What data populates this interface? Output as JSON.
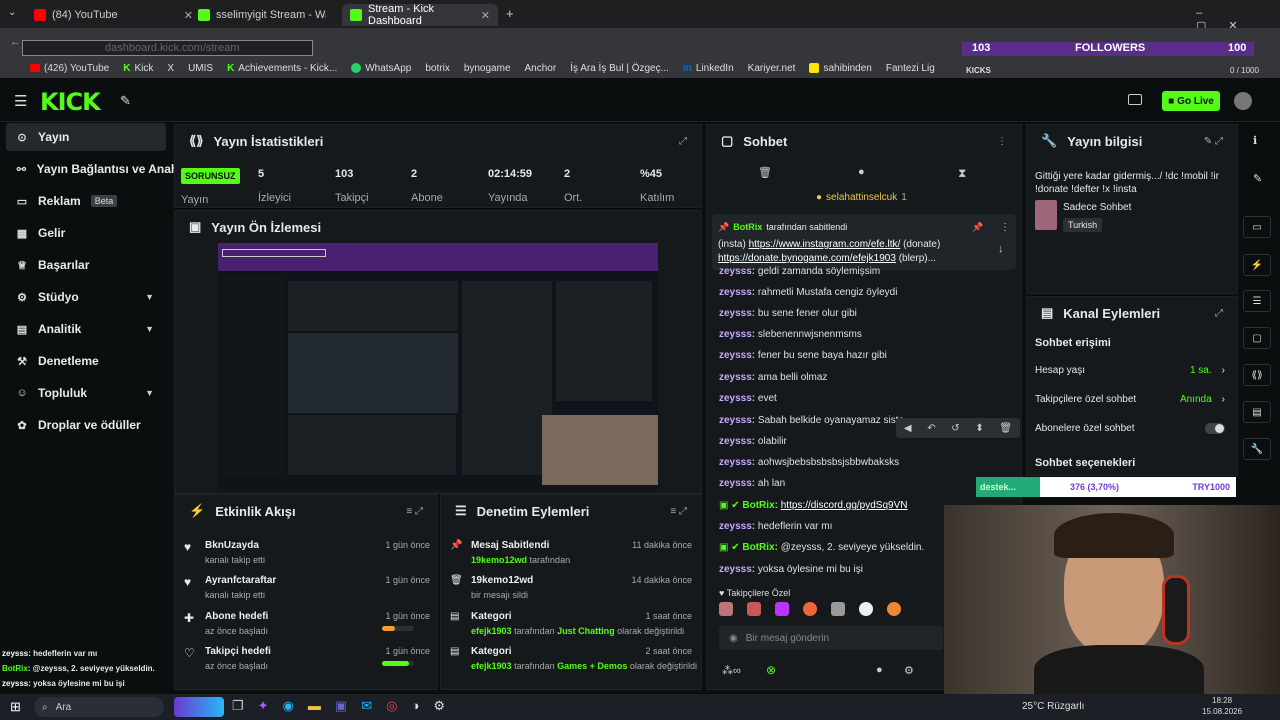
{
  "browser": {
    "tabs": [
      {
        "label": "(84) YouTube",
        "active": false
      },
      {
        "label": "sselimyigit Stream - Watch Live",
        "active": false
      },
      {
        "label": "Stream - Kick Dashboard",
        "active": true
      }
    ],
    "url": "dashboard.kick.com/stream",
    "bookmarks": [
      "(426) YouTube",
      "Kick",
      "X",
      "UMIS",
      "Achievements - Kick...",
      "WhatsApp",
      "botrix",
      "bynogame",
      "Anchor",
      "İş Ara İş Bul | Özgeç...",
      "LinkedIn",
      "Kariyer.net",
      "sahibinden",
      "Fantezi Lig"
    ]
  },
  "overlay": {
    "followers_left": "103",
    "followers_label": "FOLLOWERS",
    "followers_right": "100",
    "kicks_label": "KICKS",
    "kicks_value": "0 / 1000",
    "donation_name": "destek...",
    "donation_pct": "376 (3,70%)",
    "donation_goal": "TRY1000"
  },
  "header": {
    "logo": "KICK",
    "golive": "Go Live"
  },
  "sidebar": {
    "items": [
      {
        "label": "Yayın",
        "icon": "broadcast-icon"
      },
      {
        "label": "Yayın Bağlantısı ve Anahtar",
        "icon": "link-icon"
      },
      {
        "label": "Reklam",
        "badge": "Beta",
        "icon": "ad-icon"
      },
      {
        "label": "Gelir",
        "icon": "revenue-icon"
      },
      {
        "label": "Başarılar",
        "icon": "trophy-icon"
      },
      {
        "label": "Stüdyo",
        "icon": "studio-icon"
      },
      {
        "label": "Analitik",
        "icon": "chart-icon"
      },
      {
        "label": "Denetleme",
        "icon": "hammer-icon"
      },
      {
        "label": "Topluluk",
        "icon": "community-icon"
      },
      {
        "label": "Droplar ve ödüller",
        "icon": "gift-icon"
      }
    ]
  },
  "stats": {
    "title": "Yayın İstatistikleri",
    "badge": "SORUNSUZ",
    "badge_label": "Yayın",
    "items": [
      {
        "value": "5",
        "label": "İzleyici"
      },
      {
        "value": "103",
        "label": "Takipçi"
      },
      {
        "value": "2",
        "label": "Abone"
      },
      {
        "value": "02:14:59",
        "label": "Yayında"
      },
      {
        "value": "2",
        "label": "Ort."
      },
      {
        "value": "%45",
        "label": "Katılım"
      }
    ]
  },
  "preview": {
    "title": "Yayın Ön İzlemesi"
  },
  "chat": {
    "title": "Sohbet",
    "pinned_user": "selahattinselcuk",
    "pinned_count": "1",
    "pinned_by": "BotRix",
    "pinned_by_suffix": "tarafından sabitlendi",
    "pinned_text_1_pre": "(insta)",
    "pinned_link_1": "https://www.instagram.com/efe.ltk/",
    "pinned_text_1_post": "(donate)",
    "pinned_link_2": "https://donate.bynogame.com/efejk1903",
    "pinned_text_2_post": "(blerp)...",
    "messages": [
      {
        "user": "zeysss:",
        "text": "geldi zamanda söylemişsim"
      },
      {
        "user": "zeysss:",
        "text": "rahmetli Mustafa cengiz öyleydi"
      },
      {
        "user": "zeysss:",
        "text": "bu sene fener olur gibi"
      },
      {
        "user": "zeysss:",
        "text": "slebenennwjsnenmsms"
      },
      {
        "user": "zeysss:",
        "text": "fener bu sene baya hazır gibi"
      },
      {
        "user": "zeysss:",
        "text": "ama belli olmaz"
      },
      {
        "user": "zeysss:",
        "text": "evet"
      },
      {
        "user": "zeysss:",
        "text": "Sabah belkide oyanayamaz siste"
      },
      {
        "user": "zeysss:",
        "text": "olabilir"
      },
      {
        "user": "zeysss:",
        "text": "aohwsjbebsbsbsbsjsbbwbaksks"
      },
      {
        "user": "zeysss:",
        "text": "ah lan"
      },
      {
        "user": "BotRix:",
        "text": "https://discord.gg/pydSq9VN",
        "bot": true
      },
      {
        "user": "zeysss:",
        "text": "hedeflerin var mı"
      },
      {
        "user": "BotRix:",
        "text": "@zeysss, 2. seviyeye yükseldin.",
        "bot": true
      },
      {
        "user": "zeysss:",
        "text": "yoksa öylesine mi bu işi"
      }
    ],
    "followers_only": "Takipçilere Özel",
    "input_placeholder": "Bir mesaj gönderin"
  },
  "info": {
    "title": "Yayın bilgisi",
    "stream_title": "Gittiği yere kadar gidermiş.../ !dc !mobil !ir !donate !defter !x !insta",
    "category": "Sadece Sohbet",
    "tag": "Turkish"
  },
  "actions": {
    "title": "Kanal Eylemleri",
    "section": "Sohbet erişimi",
    "rows": [
      {
        "label": "Hesap yaşı",
        "value": "1 sa."
      },
      {
        "label": "Takipçilere özel sohbet",
        "value": "Anında"
      },
      {
        "label": "Abonelere özel sohbet",
        "value": ""
      }
    ],
    "section2": "Sohbet seçenekleri"
  },
  "activity": {
    "title": "Etkinlik Akışı",
    "items": [
      {
        "title": "BknUzayda",
        "sub": "kanalı takip etti",
        "time": "1 gün önce"
      },
      {
        "title": "Ayranfctaraftar",
        "sub": "kanalı takip etti",
        "time": "1 gün önce"
      },
      {
        "title": "Abone hedefi",
        "sub": "az önce başladı",
        "time": "1 gün önce",
        "progress": 0.4
      },
      {
        "title": "Takipçi hedefi",
        "sub": "az önce başladı",
        "time": "1 gün önce",
        "progress": 0.85
      }
    ]
  },
  "moderation": {
    "title": "Denetim Eylemleri",
    "items": [
      {
        "title": "Mesaj Sabitlendi",
        "sub_user": "19kemo12wd",
        "sub_text": "tarafından",
        "time": "11 dakika önce"
      },
      {
        "title": "19kemo12wd",
        "sub_user": "",
        "sub_text": "bir mesajı sildi",
        "time": "14 dakika önce"
      },
      {
        "title": "Kategori",
        "sub_user": "efejk1903",
        "sub_text": "tarafından",
        "highlight": "Just Chatting",
        "sub_end": "olarak değiştirildi",
        "time": "1 saat önce"
      },
      {
        "title": "Kategori",
        "sub_user": "efejk1903",
        "sub_text": "tarafından",
        "highlight": "Games + Demos",
        "sub_end": "olarak değiştirildi",
        "time": "2 saat önce"
      }
    ]
  },
  "overlay_chat": [
    {
      "user": "zeysss",
      "text": ": hedeflerin var mı"
    },
    {
      "user": "BotRix",
      "text": ": @zeysss, 2. seviyeye yükseldin."
    },
    {
      "user": "zeysss",
      "text": ": yoksa öylesine mi bu işi"
    }
  ],
  "taskbar": {
    "search": "Ara",
    "weather": "25°C  Rüzgarlı",
    "time": "18:28",
    "date": "15.08.2026"
  },
  "colors": {
    "accent": "#53fc18",
    "bg": "#0b0e0f",
    "panel": "#15191b",
    "chat_user": "#c9a8ff"
  }
}
